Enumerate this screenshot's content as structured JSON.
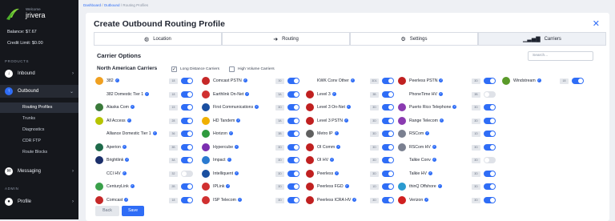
{
  "user": {
    "welcome": "Welcome",
    "name": "jrivera"
  },
  "account": {
    "balance": "Balance: $7.67",
    "credit": "Credit Limit: $0.00"
  },
  "sidebar": {
    "sections": [
      "PRODUCTS",
      "ADMIN"
    ],
    "items": [
      {
        "label": "Inbound",
        "icon": "phone-in-icon"
      },
      {
        "label": "Outbound",
        "icon": "phone-out-icon"
      },
      {
        "label": "Messaging",
        "icon": "message-icon"
      },
      {
        "label": "Profile",
        "icon": "user-icon"
      }
    ],
    "subitems": [
      "Routing Profiles",
      "Trunks",
      "Diagnostics",
      "CDR FTP",
      "Route Blocks"
    ]
  },
  "breadcrumb": [
    "Dashboard",
    "Outbound",
    "Routing Profiles"
  ],
  "page": {
    "title": "Create Outbound Routing Profile"
  },
  "tabs": [
    {
      "label": "Location",
      "icon": "globe-icon"
    },
    {
      "label": "Routing",
      "icon": "arrow-right-icon"
    },
    {
      "label": "Settings",
      "icon": "gears-icon"
    },
    {
      "label": "Carriers",
      "icon": "signal-icon"
    }
  ],
  "carrier_options": {
    "heading": "Carrier Options",
    "search_placeholder": "Search..."
  },
  "region": {
    "heading": "North American Carriers",
    "filters": [
      {
        "label": "Long Distance Carriers",
        "checked": true
      },
      {
        "label": "High Volume Carriers",
        "checked": false
      }
    ]
  },
  "carriers": [
    [
      {
        "name": "382",
        "badge": "18",
        "on": true,
        "color": "#f0a020"
      },
      {
        "name": "382 Domestic Tier 1",
        "badge": "18",
        "on": true,
        "color": ""
      },
      {
        "name": "Alaska Com",
        "badge": "15",
        "on": true,
        "color": "#3a7a3a"
      },
      {
        "name": "All Access",
        "badge": "28",
        "on": true,
        "color": "#b6c400"
      },
      {
        "name": "Alliance Domestic Tier 1",
        "badge": "36",
        "on": true,
        "color": ""
      },
      {
        "name": "Aperion",
        "badge": "3B",
        "on": true,
        "color": "#1e6a4a"
      },
      {
        "name": "Brightlink",
        "badge": "3A",
        "on": true,
        "color": "#1b2f6a"
      },
      {
        "name": "CCI HV",
        "badge": "32",
        "on": false,
        "color": ""
      },
      {
        "name": "CenturyLink",
        "badge": "2B",
        "on": true,
        "color": "#3aa04a"
      },
      {
        "name": "Comcast",
        "badge": "18",
        "on": true,
        "color": "#c62828"
      }
    ],
    [
      {
        "name": "Comcast PSTN",
        "badge": "30",
        "on": true,
        "color": "#c62828"
      },
      {
        "name": "Earthlink On-Net",
        "badge": "3A",
        "on": true,
        "color": "#d03030"
      },
      {
        "name": "First Communications",
        "badge": "3D",
        "on": true,
        "color": "#1a4fa0"
      },
      {
        "name": "HD Tandem",
        "badge": "3A",
        "on": true,
        "color": "#f0b000"
      },
      {
        "name": "Horizon",
        "badge": "3B",
        "on": true,
        "color": "#2e9a3e"
      },
      {
        "name": "Hypercube",
        "badge": "3D",
        "on": true,
        "color": "#7b2fb0"
      },
      {
        "name": "Impact",
        "badge": "3D",
        "on": true,
        "color": "#2a7ad0"
      },
      {
        "name": "Intelliquent",
        "badge": "3D",
        "on": true,
        "color": "#1a4fa0"
      },
      {
        "name": "IPLink",
        "badge": "3D",
        "on": true,
        "color": "#d03030"
      },
      {
        "name": "ISP Telecom",
        "badge": "3D",
        "on": true,
        "color": "#d03030"
      }
    ],
    [
      {
        "name": "KWK Conv Other",
        "badge": "3D1",
        "on": true,
        "color": ""
      },
      {
        "name": "Level 3",
        "badge": "3B",
        "on": true,
        "color": "#c02020"
      },
      {
        "name": "Level 3 On-Net",
        "badge": "3D",
        "on": true,
        "color": "#c02020"
      },
      {
        "name": "Level 3 PSTN",
        "badge": "3D",
        "on": true,
        "color": "#c02020"
      },
      {
        "name": "Metro IP",
        "badge": "3D",
        "on": true,
        "color": "#606060"
      },
      {
        "name": "OI Comm",
        "badge": "3D",
        "on": true,
        "color": "#c02020"
      },
      {
        "name": "OI HV",
        "badge": "3D",
        "on": true,
        "color": "#c02020"
      },
      {
        "name": "Peerless",
        "badge": "3D",
        "on": true,
        "color": "#c02020"
      },
      {
        "name": "Peerless FGD",
        "badge": "1D",
        "on": true,
        "color": "#c02020"
      },
      {
        "name": "Peerless ICRA HV",
        "badge": "3D",
        "on": true,
        "color": "#c02020"
      }
    ],
    [
      {
        "name": "Peerless PSTN",
        "badge": "3D",
        "on": true,
        "color": "#c02020"
      },
      {
        "name": "PhoneTime HV",
        "badge": "3B",
        "on": false,
        "color": ""
      },
      {
        "name": "Puerto Rico Telephone",
        "badge": "3D",
        "on": true,
        "color": "#8a3ab0"
      },
      {
        "name": "Range Telecom",
        "badge": "3D",
        "on": true,
        "color": "#8a3ab0"
      },
      {
        "name": "RSCom",
        "badge": "1D",
        "on": true,
        "color": "#7a8090"
      },
      {
        "name": "RSCom HV",
        "badge": "3D",
        "on": true,
        "color": "#7a8090"
      },
      {
        "name": "Talkie Conv",
        "badge": "3D",
        "on": false,
        "color": ""
      },
      {
        "name": "Talkie HV",
        "badge": "3D",
        "on": true,
        "color": ""
      },
      {
        "name": "thinQ Offshore",
        "badge": "3D",
        "on": true,
        "color": "#2a9ad0"
      },
      {
        "name": "Verizon",
        "badge": "3D",
        "on": true,
        "color": "#d02020"
      }
    ],
    [
      {
        "name": "Windstream",
        "badge": "18",
        "on": true,
        "color": "#5a9a2a"
      }
    ]
  ],
  "buttons": {
    "back": "Back",
    "save": "Save"
  },
  "colors": {
    "accent": "#2f6df6",
    "sidebar": "#15171c"
  }
}
